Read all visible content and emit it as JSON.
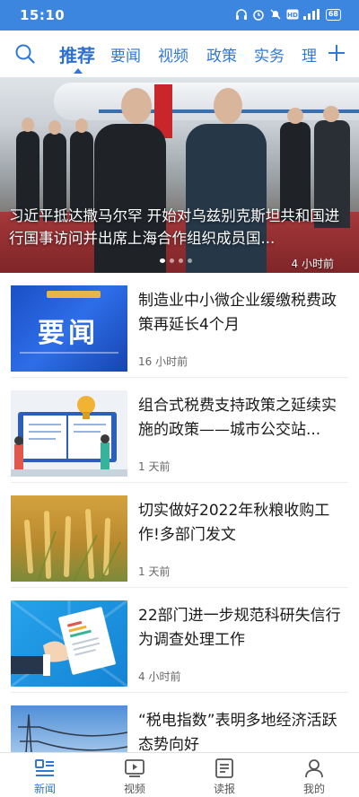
{
  "status_bar": {
    "time": "15:10",
    "battery": "68",
    "icons": [
      "headset-icon",
      "alarm-icon",
      "mute-icon",
      "hd-icon",
      "signal-icon",
      "battery-icon"
    ]
  },
  "top_nav": {
    "tabs": [
      {
        "label": "推荐",
        "active": true
      },
      {
        "label": "要闻",
        "active": false
      },
      {
        "label": "视频",
        "active": false
      },
      {
        "label": "政策",
        "active": false
      },
      {
        "label": "实务",
        "active": false
      },
      {
        "label": "理",
        "active": false
      }
    ],
    "accent_color": "#2f78d6",
    "status_bar_color": "#3c86df"
  },
  "hero": {
    "caption": "习近平抵达撒马尔罕 开始对乌兹别克斯坦共和国进行国事访问并出席上海合作组织成员国...",
    "time": "4 小时前",
    "dots_count": 4,
    "active_dot": 0
  },
  "news": [
    {
      "title": "制造业中小微企业缓缴税费政策再延长4个月",
      "time": "16 小时前",
      "thumb_text": "要闻"
    },
    {
      "title": "组合式税费支持政策之延续实施的政策——城市公交站...",
      "time": "1 天前"
    },
    {
      "title": "切实做好2022年秋粮收购工作!多部门发文",
      "time": "1 天前"
    },
    {
      "title": "22部门进一步规范科研失信行为调查处理工作",
      "time": "4 小时前"
    },
    {
      "title": "“税电指数”表明多地经济活跃态势向好",
      "time": ""
    }
  ],
  "tabbar": [
    {
      "label": "新闻",
      "active": true,
      "icon": "news-icon"
    },
    {
      "label": "视频",
      "active": false,
      "icon": "video-icon"
    },
    {
      "label": "读报",
      "active": false,
      "icon": "newspaper-icon"
    },
    {
      "label": "我的",
      "active": false,
      "icon": "profile-icon"
    }
  ]
}
